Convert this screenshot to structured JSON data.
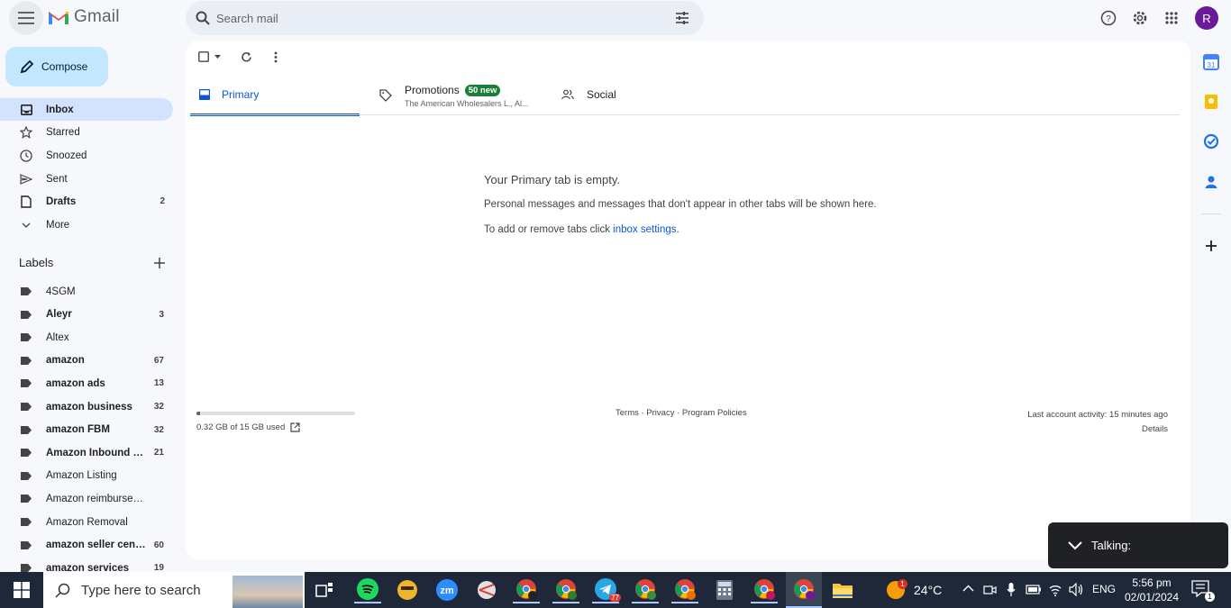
{
  "app": {
    "name": "Gmail"
  },
  "search": {
    "placeholder": "Search mail"
  },
  "user": {
    "initial": "R",
    "avatar_color": "#6a1b9a"
  },
  "compose": {
    "label": "Compose"
  },
  "nav": [
    {
      "label": "Inbox",
      "count": "",
      "icon": "inbox-icon",
      "active": true
    },
    {
      "label": "Starred",
      "count": "",
      "icon": "star-icon"
    },
    {
      "label": "Snoozed",
      "count": "",
      "icon": "clock-icon"
    },
    {
      "label": "Sent",
      "count": "",
      "icon": "send-icon"
    },
    {
      "label": "Drafts",
      "count": "2",
      "icon": "draft-icon"
    },
    {
      "label": "More",
      "count": "",
      "icon": "chevron-down-icon"
    }
  ],
  "labels": {
    "heading": "Labels",
    "items": [
      {
        "name": "4SGM",
        "count": "",
        "bold": false
      },
      {
        "name": "Aleyr",
        "count": "3",
        "bold": true
      },
      {
        "name": "Altex",
        "count": "",
        "bold": false
      },
      {
        "name": "amazon",
        "count": "67",
        "bold": true
      },
      {
        "name": "amazon ads",
        "count": "13",
        "bold": true
      },
      {
        "name": "amazon business",
        "count": "32",
        "bold": true
      },
      {
        "name": "amazon FBM",
        "count": "32",
        "bold": true
      },
      {
        "name": "Amazon Inbound S…",
        "count": "21",
        "bold": true
      },
      {
        "name": "Amazon Listing",
        "count": "",
        "bold": false
      },
      {
        "name": "Amazon reimbursement",
        "count": "",
        "bold": false
      },
      {
        "name": "Amazon Removal",
        "count": "",
        "bold": false
      },
      {
        "name": "amazon seller cen…",
        "count": "60",
        "bold": true
      },
      {
        "name": "amazon services",
        "count": "19",
        "bold": true
      }
    ]
  },
  "tabs": {
    "primary": "Primary",
    "promotions": "Promotions",
    "promotions_badge": "50 new",
    "promotions_sub": "The American Wholesalers L., Al...",
    "social": "Social"
  },
  "empty": {
    "title": "Your Primary tab is empty.",
    "desc": "Personal messages and messages that don't appear in other tabs will be shown here.",
    "settings_prefix": "To add or remove tabs click ",
    "settings_link": "inbox settings",
    "settings_suffix": "."
  },
  "storage": {
    "text": "0.32 GB of 15 GB used",
    "fraction": 0.021
  },
  "footer": {
    "links": "Terms · Privacy · Program Policies"
  },
  "activity": {
    "text": "Last account activity: 15 minutes ago",
    "details": "Details"
  },
  "talking": {
    "label": "Talking:"
  },
  "taskbar": {
    "search_text": "Type here to search",
    "temperature": "24°C",
    "language": "ENG",
    "time": "5:56 pm",
    "date": "02/01/2024",
    "notification_badge": "1",
    "telegram_badge": "77",
    "notif_count": "1"
  },
  "colors": {
    "accent": "#0b57d0",
    "compose_bg": "#c2e7ff",
    "active_nav": "#d3e3fd",
    "badge": "#188038"
  }
}
